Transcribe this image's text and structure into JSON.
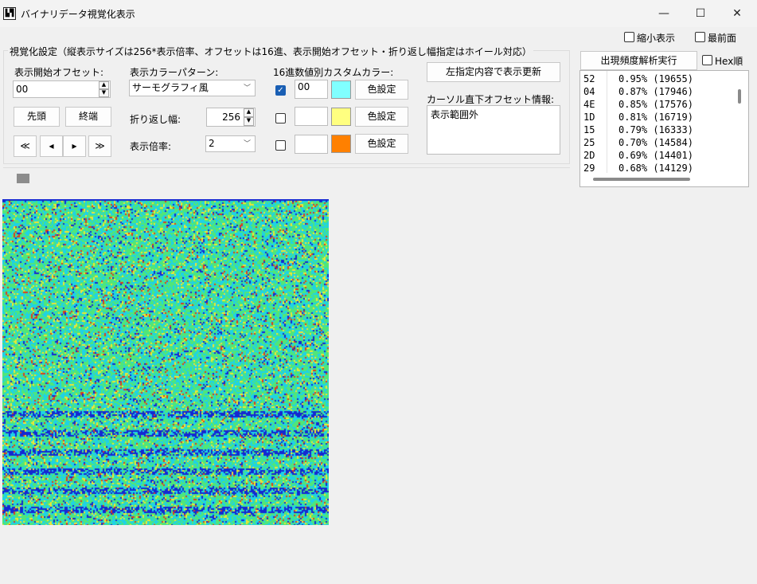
{
  "window": {
    "title": "バイナリデータ視覚化表示",
    "icon_glyph": "▙▜",
    "minimize": "—",
    "maximize": "☐",
    "close": "✕"
  },
  "top_options": {
    "shrink_label": "縮小表示",
    "topmost_label": "最前面"
  },
  "settings": {
    "group_title": "視覚化設定（縦表示サイズは256*表示倍率、オフセットは16進、表示開始オフセット・折り返し幅指定はホイール対応）",
    "start_offset_label": "表示開始オフセット:",
    "start_offset_value": "00",
    "head_button": "先頭",
    "end_button": "終端",
    "nav": {
      "first": "≪",
      "prev": "◂",
      "next": "▸",
      "last": "≫"
    },
    "color_pattern_label": "表示カラーパターン:",
    "color_pattern_value": "サーモグラフィ風",
    "wrap_width_label": "折り返し幅:",
    "wrap_width_value": "256",
    "scale_label": "表示倍率:",
    "scale_value": "2",
    "custom_color_label": "16進数値別カスタムカラー:",
    "custom_colors": [
      {
        "checked": true,
        "value": "00",
        "swatch": "#80ffff",
        "button": "色設定"
      },
      {
        "checked": false,
        "value": "",
        "swatch": "#ffff80",
        "button": "色設定"
      },
      {
        "checked": false,
        "value": "",
        "swatch": "#ff8000",
        "button": "色設定"
      }
    ],
    "refresh_button": "左指定内容で表示更新",
    "cursor_info_label": "カーソル直下オフセット情報:",
    "cursor_info_value": "表示範囲外"
  },
  "frequency": {
    "run_button": "出現頻度解析実行",
    "hex_order_label": "Hex順",
    "rows": [
      {
        "byte": "52",
        "stat": "0.95% (19655)"
      },
      {
        "byte": "04",
        "stat": "0.87% (17946)"
      },
      {
        "byte": "4E",
        "stat": "0.85% (17576)"
      },
      {
        "byte": "1D",
        "stat": "0.81% (16719)"
      },
      {
        "byte": "15",
        "stat": "0.79% (16333)"
      },
      {
        "byte": "25",
        "stat": "0.70% (14584)"
      },
      {
        "byte": "2D",
        "stat": "0.69% (14401)"
      },
      {
        "byte": "29",
        "stat": "0.68% (14129)"
      }
    ]
  },
  "colors": {
    "accent": "#1a5fb4",
    "thermo_blue": "#1428d2",
    "thermo_cyan": "#1ed2e6",
    "thermo_green": "#50e678",
    "thermo_yellow": "#f0e632",
    "thermo_red": "#dc3c1e"
  }
}
